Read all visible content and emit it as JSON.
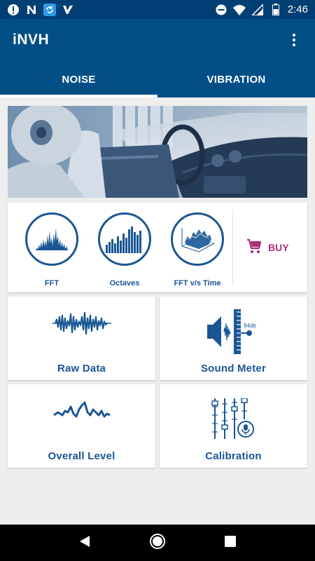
{
  "status_bar": {
    "time": "2:46",
    "left_icons": [
      "alert-icon",
      "n-notification-icon",
      "sync-app-icon",
      "checklist-app-icon"
    ],
    "right_icons": [
      "do-not-disturb-icon",
      "wifi-icon",
      "signal-icon",
      "battery-icon"
    ]
  },
  "app_bar": {
    "title": "iNVH",
    "menu_icon": "more-vert-icon"
  },
  "tabs": [
    {
      "label": "NOISE",
      "active": true
    },
    {
      "label": "VIBRATION",
      "active": false
    }
  ],
  "analysis": {
    "items": [
      {
        "label": "FFT",
        "icon": "fft-spectrum-icon"
      },
      {
        "label": "Octaves",
        "icon": "octave-bars-icon"
      },
      {
        "label": "FFT v/s Time",
        "icon": "waterfall-plot-icon"
      }
    ],
    "buy_label": "BUY",
    "buy_icon": "cart-icon"
  },
  "tiles": [
    {
      "label": "Raw Data",
      "icon": "waveform-icon"
    },
    {
      "label": "Sound Meter",
      "icon": "sound-meter-icon",
      "meter_text": "94db"
    },
    {
      "label": "Overall Level",
      "icon": "level-trend-icon"
    },
    {
      "label": "Calibration",
      "icon": "calibration-sliders-icon"
    }
  ],
  "colors": {
    "status_bar": "#003e73",
    "app_bar": "#024f86",
    "accent_blue": "#1a5694",
    "buy": "#ad2d7a",
    "background": "#eeeeee"
  },
  "nav_bar": {
    "icons": [
      "back-icon",
      "home-icon",
      "recents-icon"
    ]
  }
}
